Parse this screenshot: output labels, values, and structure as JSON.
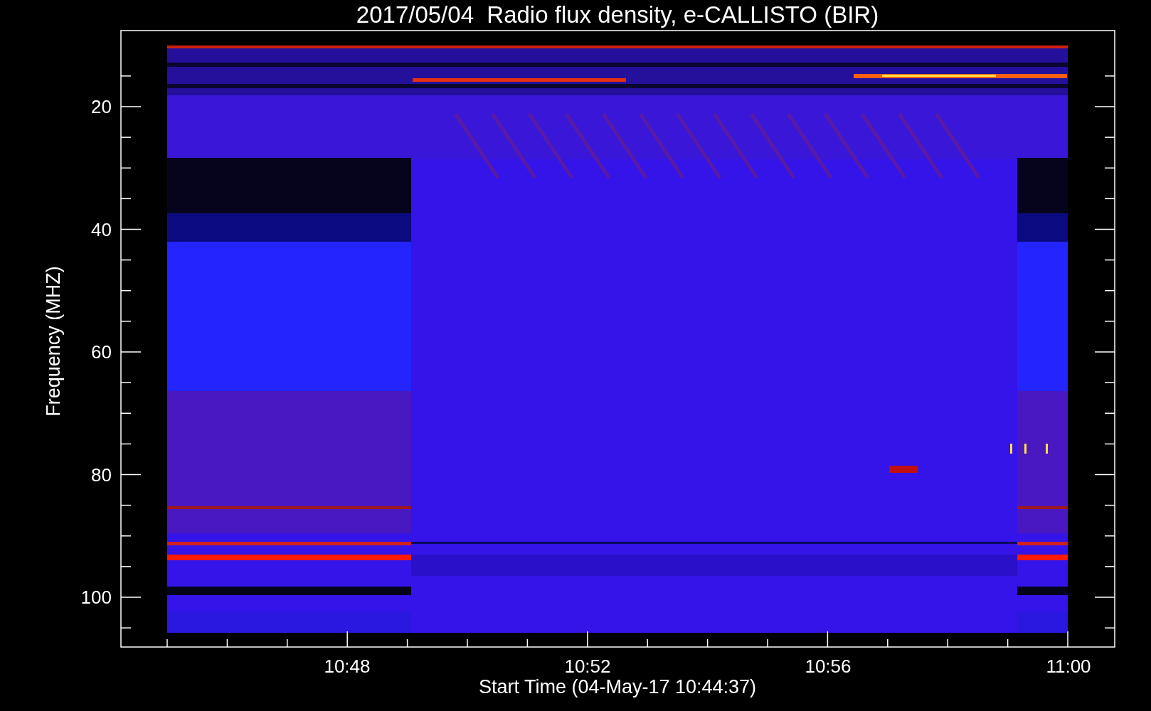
{
  "title": "2017/05/04  Radio flux density, e-CALLISTO (BIR)",
  "plot": {
    "ylabel": "Frequency (MHZ)",
    "xlabel": "Start Time (04-May-17 10:44:37)",
    "yticks": [
      "20",
      "40",
      "60",
      "80",
      "100"
    ],
    "xticks": [
      "10:48",
      "10:52",
      "10:56",
      "11:00"
    ]
  }
}
